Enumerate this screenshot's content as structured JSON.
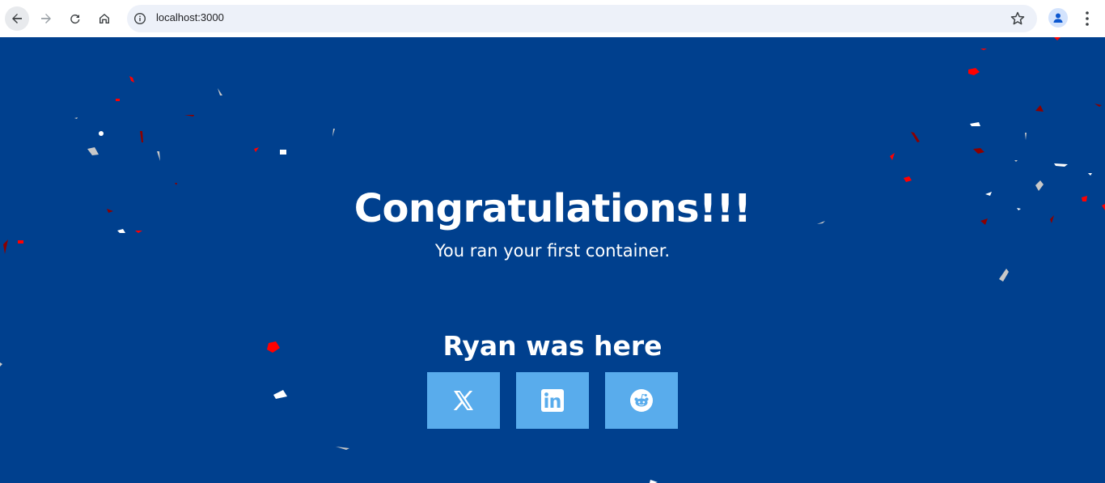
{
  "browser": {
    "url": "localhost:3000",
    "icons": {
      "back": "arrow-left-icon",
      "forward": "arrow-right-icon",
      "reload": "reload-icon",
      "home": "home-icon",
      "site_info": "info-icon",
      "bookmark": "star-icon",
      "profile": "person-icon",
      "menu": "more-vert-icon"
    }
  },
  "main": {
    "title": "Congratulations!!!",
    "subtitle": "You ran your first container.",
    "signature": "Ryan was here",
    "share_buttons": [
      {
        "icon": "x-logo-icon"
      },
      {
        "icon": "linkedin-logo-icon"
      },
      {
        "icon": "reddit-logo-icon"
      }
    ]
  },
  "colors": {
    "background": "#00408e",
    "button": "#59acec",
    "text": "#ffffff",
    "confetti": [
      "#ff0000",
      "#8b0000",
      "#ffffff",
      "#c8c8c8"
    ]
  }
}
